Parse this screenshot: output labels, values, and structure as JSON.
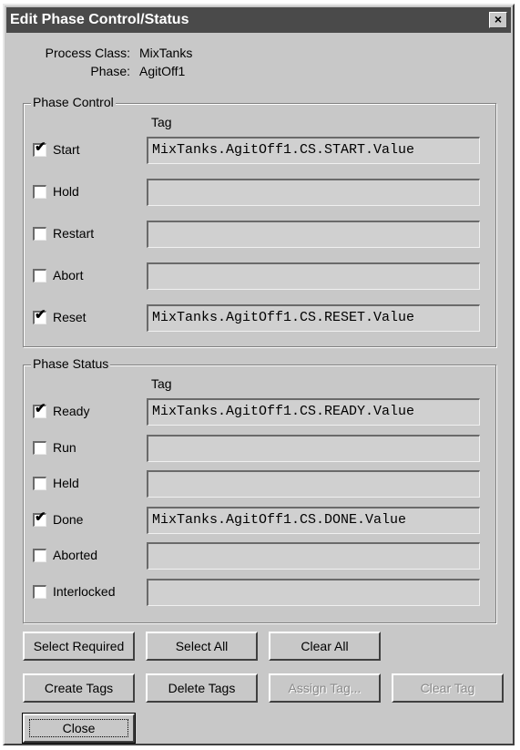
{
  "window": {
    "title": "Edit Phase Control/Status",
    "close_glyph": "×"
  },
  "info": {
    "process_class_label": "Process Class:",
    "process_class_value": "MixTanks",
    "phase_label": "Phase:",
    "phase_value": "AgitOff1"
  },
  "phase_control": {
    "title": "Phase Control",
    "tag_header": "Tag",
    "rows": [
      {
        "label": "Start",
        "checked": true,
        "tag": "MixTanks.AgitOff1.CS.START.Value"
      },
      {
        "label": "Hold",
        "checked": false,
        "tag": ""
      },
      {
        "label": "Restart",
        "checked": false,
        "tag": ""
      },
      {
        "label": "Abort",
        "checked": false,
        "tag": ""
      },
      {
        "label": "Reset",
        "checked": true,
        "tag": "MixTanks.AgitOff1.CS.RESET.Value"
      }
    ]
  },
  "phase_status": {
    "title": "Phase Status",
    "tag_header": "Tag",
    "rows": [
      {
        "label": "Ready",
        "checked": true,
        "tag": "MixTanks.AgitOff1.CS.READY.Value"
      },
      {
        "label": "Run",
        "checked": false,
        "tag": ""
      },
      {
        "label": "Held",
        "checked": false,
        "tag": ""
      },
      {
        "label": "Done",
        "checked": true,
        "tag": "MixTanks.AgitOff1.CS.DONE.Value"
      },
      {
        "label": "Aborted",
        "checked": false,
        "tag": ""
      },
      {
        "label": "Interlocked",
        "checked": false,
        "tag": ""
      }
    ]
  },
  "buttons": {
    "select_required": "Select Required",
    "select_all": "Select All",
    "clear_all": "Clear All",
    "create_tags": "Create Tags",
    "delete_tags": "Delete Tags",
    "assign_tag": "Assign Tag...",
    "clear_tag": "Clear Tag",
    "close": "Close"
  },
  "checkmark_glyph": "✔",
  "colors": {
    "titlebar": "#4a4a4a",
    "dialog_face": "#c8c8c8"
  }
}
